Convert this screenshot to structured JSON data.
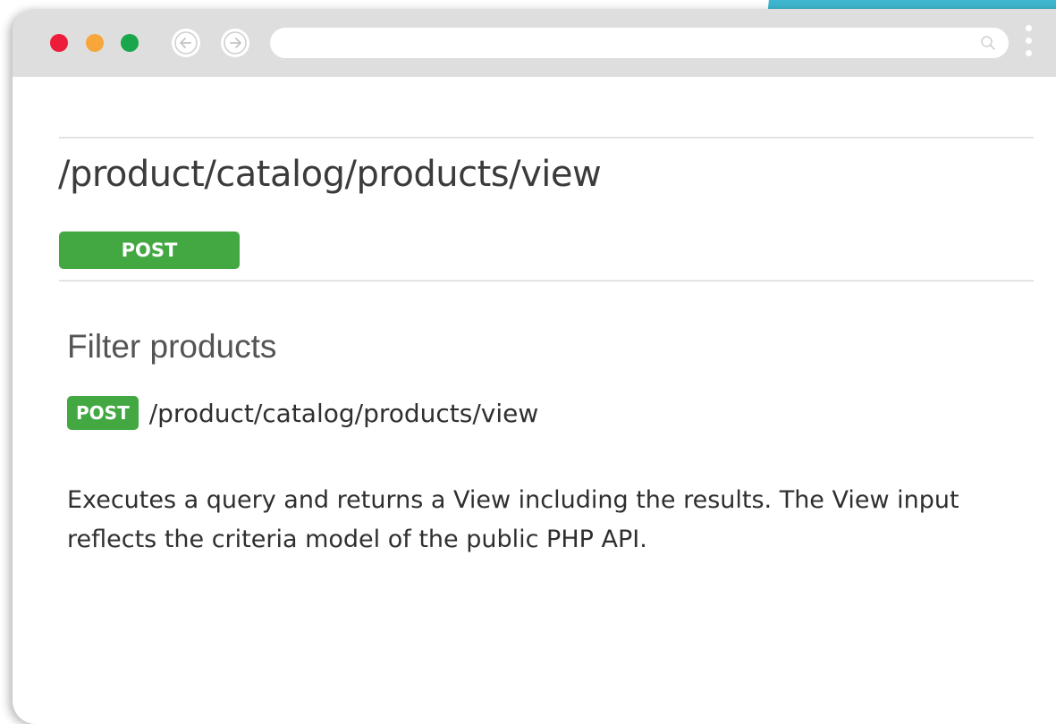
{
  "browser": {
    "back_icon": "arrow-left-icon",
    "forward_icon": "arrow-right-icon",
    "address_value": "",
    "search_icon": "search-icon",
    "menu_icon": "kebab-menu-icon",
    "traffic_light_colors": [
      "#ec1c3a",
      "#f7a63a",
      "#1aa64b"
    ]
  },
  "endpoint": {
    "path_title": "/product/catalog/products/view",
    "method_label": "POST",
    "method_color": "#43a842"
  },
  "operation": {
    "heading": "Filter products",
    "method_badge": "POST",
    "path": "/product/catalog/products/view",
    "description": "Executes a query and returns a View including the results. The View input reflects the criteria model of the public PHP API."
  }
}
